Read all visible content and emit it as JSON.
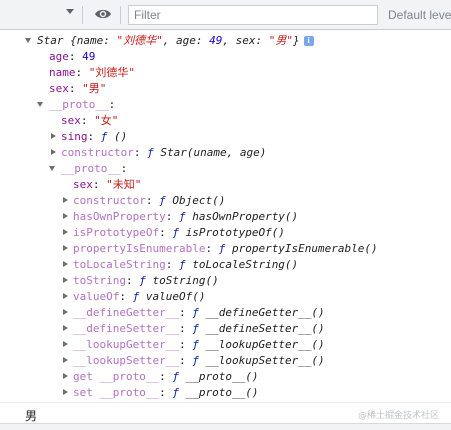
{
  "toolbar": {
    "filter_placeholder": "Filter",
    "levels_label": "Default levels"
  },
  "object": {
    "class_name": "Star",
    "preview_open": " {name: ",
    "name_value": "\"刘德华\"",
    "preview_age_key": ", age: ",
    "age_value": "49",
    "preview_sex_key": ", sex: ",
    "sex_value": "\"男\"",
    "preview_close": "}",
    "info_icon": "i",
    "props": [
      {
        "key": "age",
        "value": "49",
        "type": "number"
      },
      {
        "key": "name",
        "value": "\"刘德华\"",
        "type": "string"
      },
      {
        "key": "sex",
        "value": "\"男\"",
        "type": "string"
      }
    ]
  },
  "proto1": {
    "label": "__proto__",
    "sex_key": "sex",
    "sex_value": "\"女\"",
    "sing_key": "sing",
    "sing_value": "() ",
    "constructor_key": "constructor",
    "constructor_value": "Star(uname, age)"
  },
  "proto2": {
    "label": "__proto__",
    "sex_key": "sex",
    "sex_value": "\"未知\"",
    "methods": [
      {
        "key": "constructor",
        "value": "Object()"
      },
      {
        "key": "hasOwnProperty",
        "value": "hasOwnProperty()"
      },
      {
        "key": "isPrototypeOf",
        "value": "isPrototypeOf()"
      },
      {
        "key": "propertyIsEnumerable",
        "value": "propertyIsEnumerable()"
      },
      {
        "key": "toLocaleString",
        "value": "toLocaleString()"
      },
      {
        "key": "toString",
        "value": "toString()"
      },
      {
        "key": "valueOf",
        "value": "valueOf()"
      },
      {
        "key": "__defineGetter__",
        "value": "__defineGetter__()"
      },
      {
        "key": "__defineSetter__",
        "value": "__defineSetter__()"
      },
      {
        "key": "__lookupGetter__",
        "value": "__lookupGetter__()"
      },
      {
        "key": "__lookupSetter__",
        "value": "__lookupSetter__()"
      },
      {
        "key": "get __proto__",
        "value": "__proto__()"
      },
      {
        "key": "set __proto__",
        "value": "__proto__()"
      }
    ]
  },
  "function_glyph": "ƒ",
  "result_text": "男",
  "watermark": "@稀土掘金技术社区",
  "colors": {
    "key": "#881391",
    "string": "#c41a16",
    "number": "#1c00cf",
    "function_keyword": "#0d22aa"
  }
}
